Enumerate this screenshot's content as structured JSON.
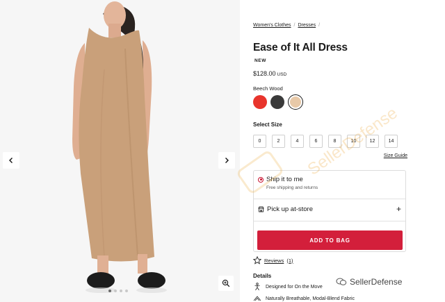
{
  "breadcrumb": {
    "items": [
      "Women's Clothes",
      "Dresses"
    ],
    "separator": "/"
  },
  "product": {
    "title": "Ease of It All Dress",
    "badge": "NEW",
    "price": "$128.00",
    "currency": "USD",
    "color_name": "Beech Wood",
    "swatches": [
      {
        "name": "red",
        "color": "#e8342c"
      },
      {
        "name": "charcoal",
        "color": "#3a3a3a"
      },
      {
        "name": "beech-wood",
        "color": "#e8c9a8",
        "selected": true
      }
    ]
  },
  "sizes": {
    "label": "Select Size",
    "options": [
      "0",
      "2",
      "4",
      "6",
      "8",
      "10",
      "12",
      "14"
    ],
    "guide_label": "Size Guide"
  },
  "fulfillment": {
    "ship_title": "Ship it to me",
    "ship_subtitle": "Free shipping and returns",
    "pickup_title": "Pick up at-store",
    "add_to_bag": "ADD TO BAG"
  },
  "reviews": {
    "label": "Reviews",
    "count": "(1)"
  },
  "details": {
    "label": "Details",
    "features": [
      "Designed for On the Move",
      "Naturally Breathable, Modal-Blend Fabric"
    ]
  },
  "gallery": {
    "image_count": 4,
    "active_index": 0,
    "dress_color": "#c9a07a"
  },
  "watermark": {
    "text": "SellerDefense",
    "diagonal": "SellerDefense"
  },
  "colors": {
    "accent": "#d31f3b",
    "background": "#ffffff"
  }
}
